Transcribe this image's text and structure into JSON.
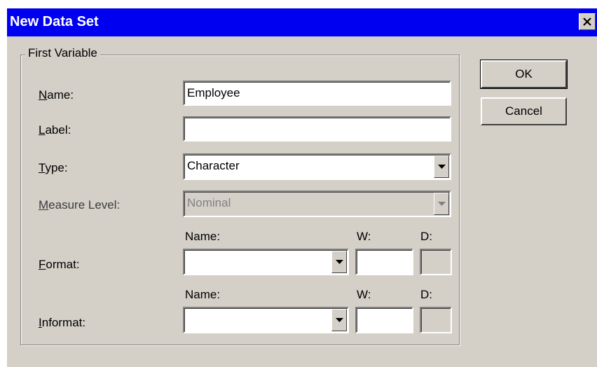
{
  "window": {
    "title": "New Data Set",
    "close_glyph": "✕"
  },
  "group": {
    "legend": "First Variable"
  },
  "fields": {
    "name": {
      "mnemonic": "N",
      "label_rest": "ame:",
      "value": "Employee"
    },
    "label": {
      "mnemonic": "L",
      "label_rest": "abel:",
      "value": ""
    },
    "type": {
      "mnemonic": "T",
      "label_rest": "ype:",
      "value": "Character"
    },
    "measure_level": {
      "mnemonic": "M",
      "label_rest": "easure Level:",
      "value": "Nominal",
      "enabled": false
    },
    "format": {
      "mnemonic": "F",
      "label_rest": "ormat:",
      "name_header": "Name:",
      "w_header": "W:",
      "d_header": "D:",
      "name_value": "",
      "w_value": "",
      "d_value": ""
    },
    "informat": {
      "mnemonic": "I",
      "label_rest": "nformat:",
      "name_header": "Name:",
      "w_header": "W:",
      "d_header": "D:",
      "name_value": "",
      "w_value": "",
      "d_value": ""
    }
  },
  "buttons": {
    "ok": "OK",
    "cancel": "Cancel"
  },
  "colors": {
    "titlebar": "#0000f0",
    "dialog_bg": "#d4d0c8"
  },
  "icons": {
    "dropdown": "chevron-down-icon",
    "close": "close-icon"
  }
}
